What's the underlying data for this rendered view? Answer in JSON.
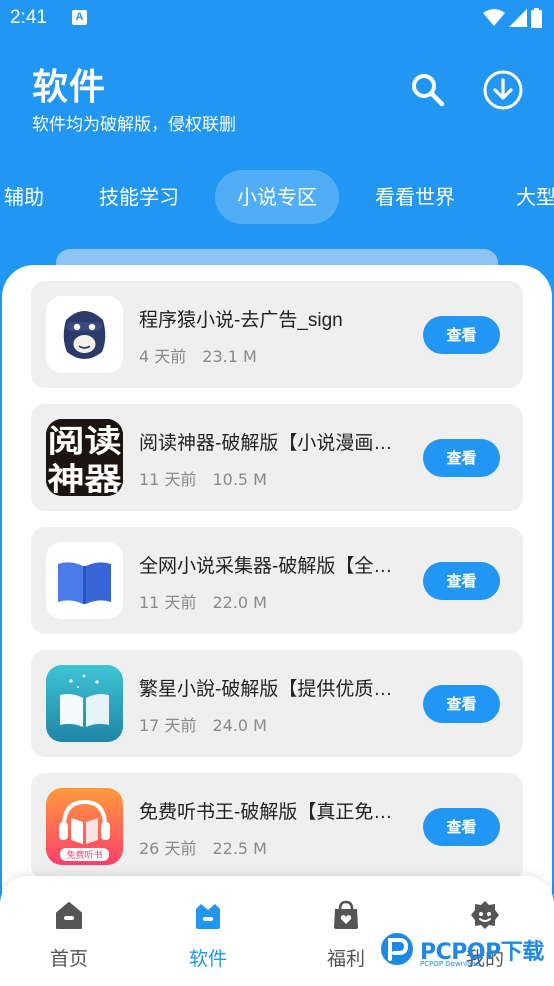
{
  "status_bar": {
    "time": "2:41",
    "notification_glyph": "A"
  },
  "header": {
    "title": "软件",
    "subtitle": "软件均为破解版，侵权联删",
    "icons": [
      "search-icon",
      "download-icon"
    ]
  },
  "tabs": [
    {
      "label": "辅助"
    },
    {
      "label": "技能学习"
    },
    {
      "label": "小说专区",
      "active": true
    },
    {
      "label": "看看世界"
    },
    {
      "label": "大型"
    }
  ],
  "apps": [
    {
      "name": "程序猿小说-去广告_sign",
      "time": "4 天前",
      "size": "23.1 M",
      "action": "查看",
      "icon": "monkey-icon"
    },
    {
      "name": "阅读神器-破解版【小说漫画听书三合一】",
      "time": "11 天前",
      "size": "10.5 M",
      "action": "查看",
      "icon": "reader-text-icon",
      "icon_text": "阅读神器"
    },
    {
      "name": "全网小说采集器-破解版【全网小说免费看】",
      "time": "11 天前",
      "size": "22.0 M",
      "action": "查看",
      "icon": "book-icon"
    },
    {
      "name": "繁星小說-破解版【提供优质小说】",
      "time": "17 天前",
      "size": "24.0 M",
      "action": "查看",
      "icon": "open-book-icon"
    },
    {
      "name": "免费听书王-破解版【真正免费听书】",
      "time": "26 天前",
      "size": "22.5 M",
      "action": "查看",
      "icon": "headphones-book-icon",
      "icon_text": "免费听书"
    }
  ],
  "bottom_nav": [
    {
      "label": "首页",
      "icon": "home-icon"
    },
    {
      "label": "软件",
      "icon": "software-icon",
      "active": true
    },
    {
      "label": "福利",
      "icon": "bag-icon"
    },
    {
      "label": "我的",
      "icon": "profile-icon"
    }
  ],
  "watermark": {
    "text": "PCPOP下载",
    "sub": "PCPOP Download"
  },
  "colors": {
    "primary": "#2196f3",
    "card_bg": "#efefef",
    "meta_text": "#8a8a8a"
  }
}
